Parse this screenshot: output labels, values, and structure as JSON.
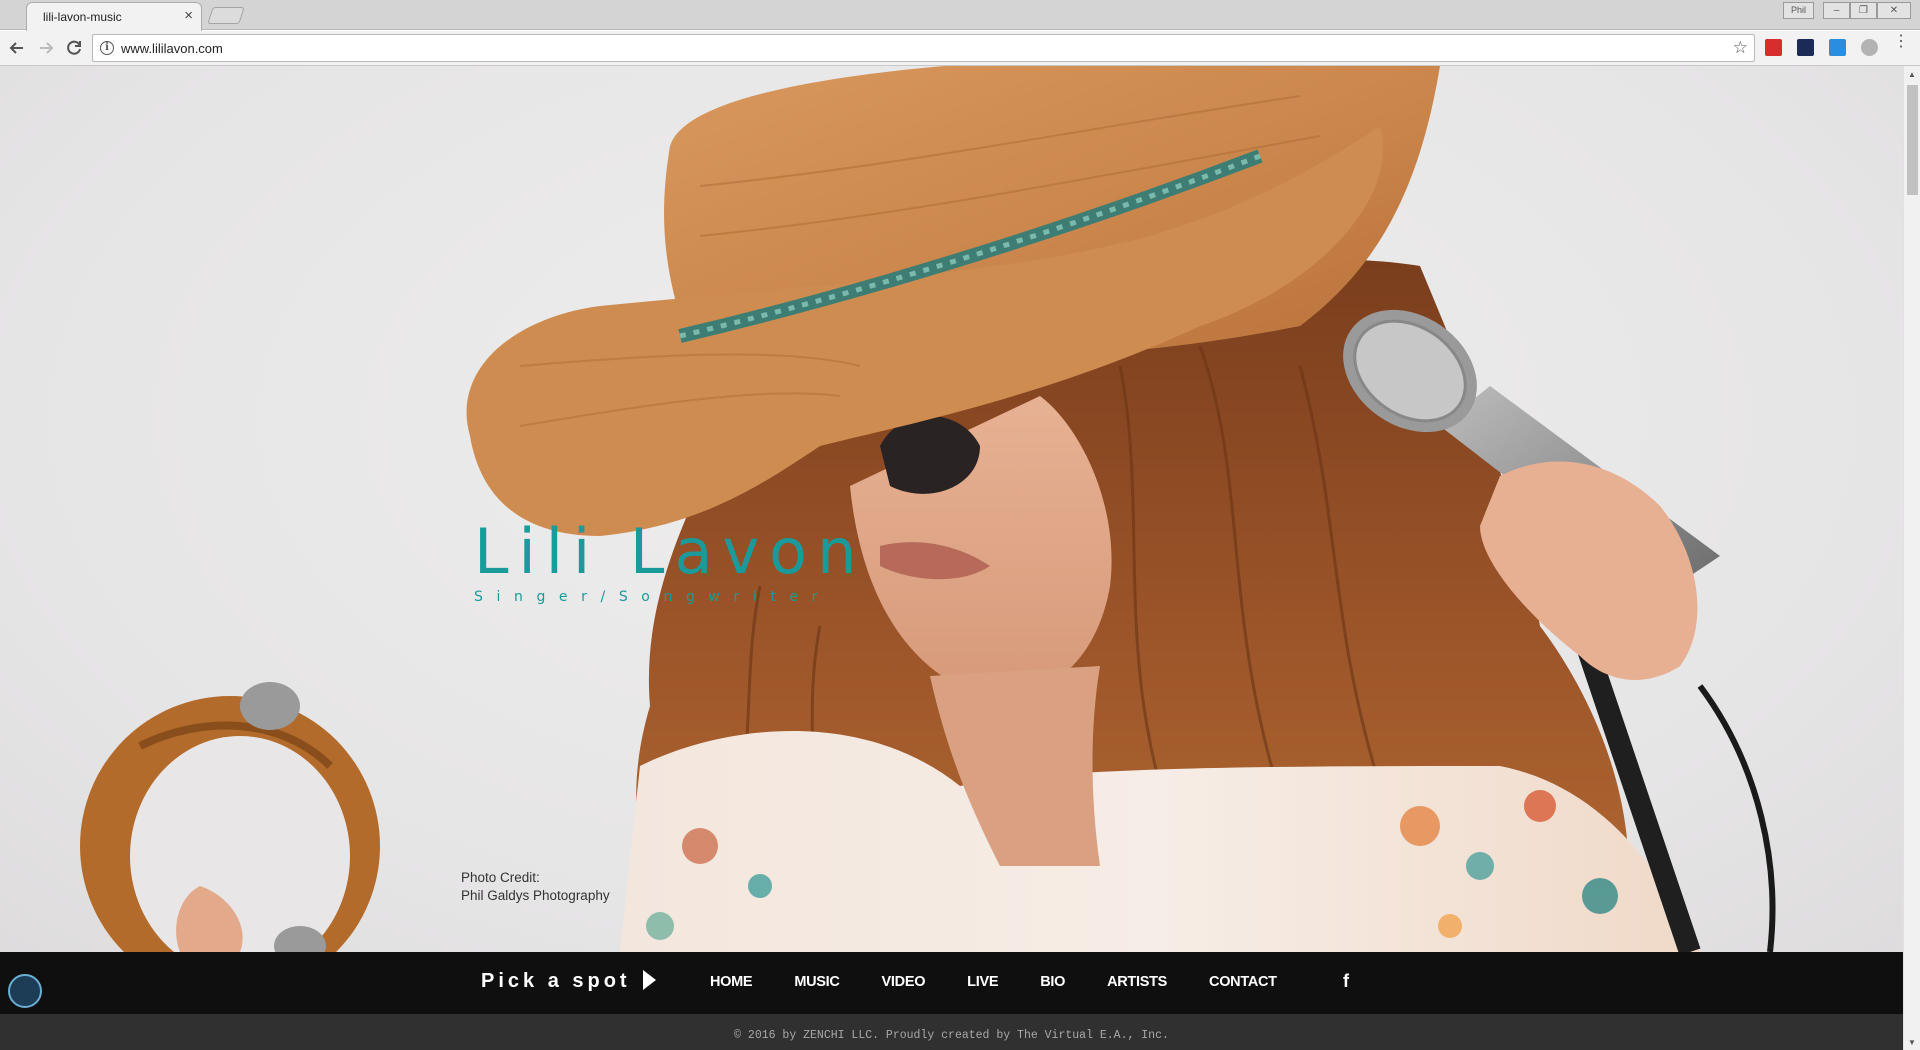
{
  "browser": {
    "tab_title": "lili-lavon-music",
    "tab_close": "×",
    "url": "www.lililavon.com",
    "window_user": "Phil",
    "win_min": "–",
    "win_max": "❐",
    "win_close": "✕",
    "icons": [
      "back-arrow-icon",
      "forward-arrow-icon",
      "reload-icon",
      "info-icon",
      "star-icon",
      "extension-icon",
      "menu-icon"
    ]
  },
  "hero": {
    "artist_name": "Lili Lavon",
    "tagline": "Singer/Songwriter",
    "credit_label": "Photo Credit:",
    "credit_name": "Phil Galdys Photography"
  },
  "nav": {
    "pick_label": "Pick a spot",
    "items": [
      "HOME",
      "MUSIC",
      "VIDEO",
      "LIVE",
      "BIO",
      "ARTISTS",
      "CONTACT"
    ],
    "facebook": "f"
  },
  "footer": {
    "text": "© 2016 by ZENCHI LLC. Proudly created by The Virtual E.A., Inc."
  },
  "colors": {
    "brand_teal": "#1a9a9a",
    "nav_bg": "#0f0f0f",
    "footer_bg": "#303030"
  }
}
